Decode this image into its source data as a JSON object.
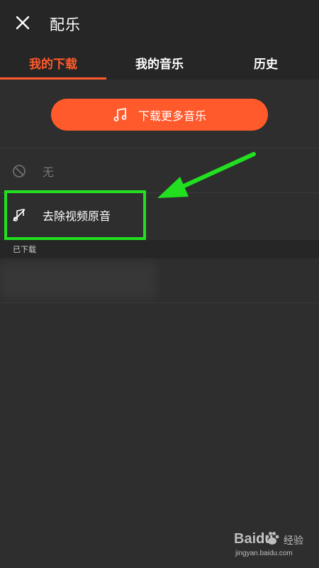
{
  "header": {
    "title": "配乐"
  },
  "tabs": [
    {
      "label": "我的下载",
      "active": true
    },
    {
      "label": "我的音乐",
      "active": false
    },
    {
      "label": "历史",
      "active": false
    }
  ],
  "download_button": {
    "label": "下载更多音乐"
  },
  "list": {
    "none_label": "无",
    "mute_label": "去除视频原音"
  },
  "section": {
    "downloaded_label": "已下载"
  },
  "watermark": {
    "logo_prefix": "Bai",
    "logo_suffix": "du",
    "jingyan": "经验",
    "url": "jingyan.baidu.com"
  },
  "colors": {
    "accent": "#ff5a2c",
    "highlight": "#22e020",
    "background": "#2e2e2e",
    "bar": "#262626"
  }
}
